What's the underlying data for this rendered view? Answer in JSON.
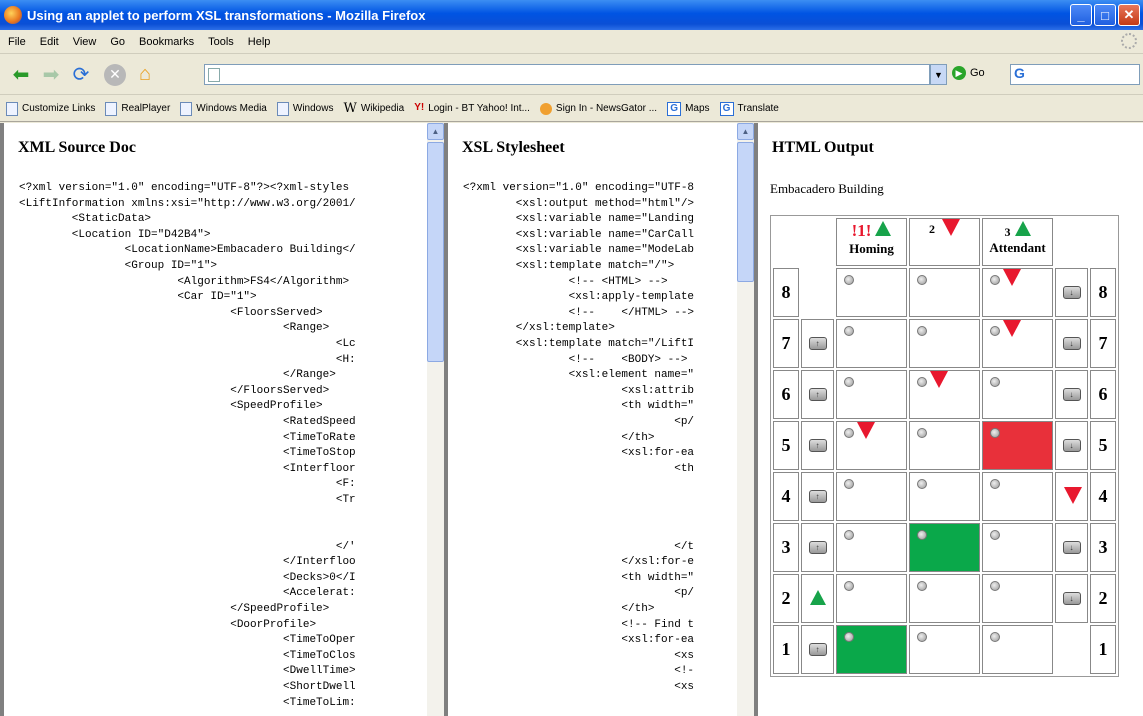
{
  "window": {
    "title": "Using an applet to perform XSL transformations - Mozilla Firefox"
  },
  "menu": [
    "File",
    "Edit",
    "View",
    "Go",
    "Bookmarks",
    "Tools",
    "Help"
  ],
  "nav": {
    "url": "",
    "go_label": "Go",
    "search_logo": "G"
  },
  "bookmarks": [
    {
      "label": "Customize Links",
      "icon": "page-icon"
    },
    {
      "label": "RealPlayer",
      "icon": "page-icon"
    },
    {
      "label": "Windows Media",
      "icon": "page-icon"
    },
    {
      "label": "Windows",
      "icon": "page-icon"
    },
    {
      "label": "Wikipedia",
      "icon": "wikipedia-icon"
    },
    {
      "label": "Login - BT Yahoo! Int...",
      "icon": "yahoo-icon"
    },
    {
      "label": "Sign In - NewsGator ...",
      "icon": "newsgator-icon"
    },
    {
      "label": "Maps",
      "icon": "google-icon"
    },
    {
      "label": "Translate",
      "icon": "google-icon"
    }
  ],
  "frames": {
    "xml": {
      "title": "XML Source Doc",
      "code": "<?xml version=\"1.0\" encoding=\"UTF-8\"?><?xml-styles\n<LiftInformation xmlns:xsi=\"http://www.w3.org/2001/\n        <StaticData>\n        <Location ID=\"D42B4\">\n                <LocationName>Embacadero Building</\n                <Group ID=\"1\">\n                        <Algorithm>FS4</Algorithm>\n                        <Car ID=\"1\">\n                                <FloorsServed>\n                                        <Range>\n                                                <Lc\n                                                <H:\n                                        </Range>\n                                </FloorsServed>\n                                <SpeedProfile>\n                                        <RatedSpeed\n                                        <TimeToRate\n                                        <TimeToStop\n                                        <Interfloor\n                                                <F:\n                                                <Tr\n\n\n                                                </'\n                                        </Interfloo\n                                        <Decks>0</I\n                                        <Accelerat:\n                                </SpeedProfile>\n                                <DoorProfile>\n                                        <TimeToOper\n                                        <TimeToClos\n                                        <DwellTime>\n                                        <ShortDwell\n                                        <TimeToLim:"
    },
    "xsl": {
      "title": "XSL Stylesheet",
      "code": "<?xml version=\"1.0\" encoding=\"UTF-8\n        <xsl:output method=\"html\"/>\n        <xsl:variable name=\"Landing\n        <xsl:variable name=\"CarCall\n        <xsl:variable name=\"ModeLab\n        <xsl:template match=\"/\">\n                <!-- <HTML> -->\n                <xsl:apply-template\n                <!--    </HTML> -->\n        </xsl:template>\n        <xsl:template match=\"/LiftI\n                <!--    <BODY> -->\n                <xsl:element name=\"\n                        <xsl:attrib\n                        <th width=\"\n                                <p/\n                        </th>\n                        <xsl:for-ea\n                                <th\n\n\n\n\n                                </t\n                        </xsl:for-e\n                        <th width=\"\n                                <p/\n                        </th>\n                        <!-- Find t\n                        <xsl:for-ea\n                                <xs\n                                <!-\n                                <xs"
    },
    "output": {
      "title": "HTML Output",
      "building": "Embacadero Building",
      "cars": [
        {
          "num": "!1!",
          "dir": "up",
          "label": "Homing"
        },
        {
          "num": "2",
          "dir": "down",
          "label": ""
        },
        {
          "num": "3",
          "dir": "up",
          "label": "Attendant"
        }
      ],
      "floors": [
        {
          "floor": "8",
          "up_call": "none",
          "cells": [
            "dot",
            "dot",
            "dot-down"
          ],
          "down_call": "button"
        },
        {
          "floor": "7",
          "up_call": "button",
          "cells": [
            "dot",
            "dot",
            "dot-down"
          ],
          "down_call": "button"
        },
        {
          "floor": "6",
          "up_call": "button",
          "cells": [
            "dot",
            "dot-down",
            "dot"
          ],
          "down_call": "button"
        },
        {
          "floor": "5",
          "up_call": "button",
          "cells": [
            "dot-down",
            "dot",
            "red"
          ],
          "down_call": "button"
        },
        {
          "floor": "4",
          "up_call": "button",
          "cells": [
            "dot",
            "dot",
            "dot"
          ],
          "down_call": "arrow-down"
        },
        {
          "floor": "3",
          "up_call": "button",
          "cells": [
            "dot",
            "green",
            "dot"
          ],
          "down_call": "button"
        },
        {
          "floor": "2",
          "up_call": "arrow-up",
          "cells": [
            "dot",
            "dot",
            "dot"
          ],
          "down_call": "button"
        },
        {
          "floor": "1",
          "up_call": "button",
          "cells": [
            "green",
            "dot",
            "dot"
          ],
          "down_call": "none"
        }
      ]
    }
  }
}
